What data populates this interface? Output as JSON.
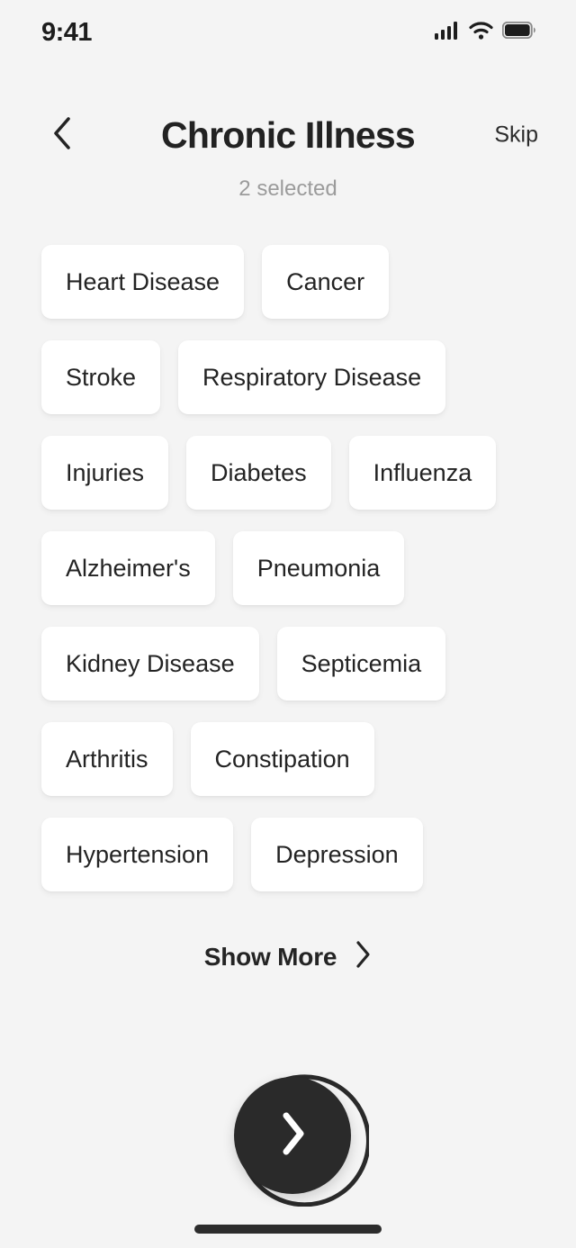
{
  "status_bar": {
    "time": "9:41",
    "icons": [
      "cellular-signal-icon",
      "wifi-icon",
      "battery-icon"
    ]
  },
  "header": {
    "back_icon": "chevron-left-icon",
    "title": "Chronic Illness",
    "skip_label": "Skip",
    "subtitle": "2 selected"
  },
  "chips": {
    "rows": [
      [
        {
          "label": "Heart Disease"
        },
        {
          "label": "Cancer"
        }
      ],
      [
        {
          "label": "Stroke"
        },
        {
          "label": "Respiratory Disease"
        }
      ],
      [
        {
          "label": "Injuries"
        },
        {
          "label": "Diabetes"
        },
        {
          "label": "Influenza"
        }
      ],
      [
        {
          "label": "Alzheimer's"
        },
        {
          "label": "Pneumonia"
        }
      ],
      [
        {
          "label": "Kidney Disease"
        },
        {
          "label": "Septicemia"
        }
      ],
      [
        {
          "label": "Arthritis"
        },
        {
          "label": "Constipation"
        }
      ],
      [
        {
          "label": "Hypertension"
        },
        {
          "label": "Depression"
        }
      ]
    ]
  },
  "show_more": {
    "label": "Show More",
    "icon": "chevron-right-icon"
  },
  "next_button": {
    "icon": "chevron-right-icon",
    "progress_ring": "partial-arc"
  },
  "colors": {
    "background": "#f4f4f4",
    "chip_background": "#ffffff",
    "text_primary": "#232323",
    "text_muted": "#9b9b9b",
    "accent_dark": "#2a2a2a"
  }
}
